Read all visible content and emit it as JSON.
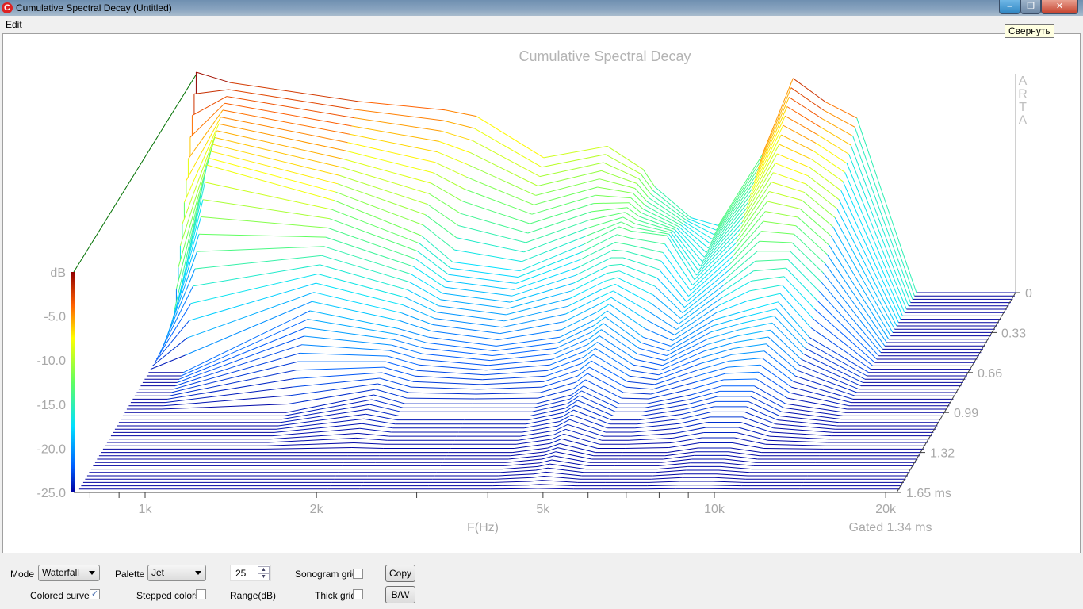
{
  "window": {
    "title": "Cumulative Spectral Decay  (Untitled)",
    "tooltip": "Свернуть",
    "minimize": "–",
    "restore": "❐",
    "close": "✕"
  },
  "menu": {
    "items": [
      "Edit"
    ]
  },
  "controls": {
    "mode_label": "Mode",
    "mode_value": "Waterfall",
    "palette_label": "Palette",
    "palette_value": "Jet",
    "range_value": "25",
    "range_label": "Range(dB)",
    "sonogram_grid_label": "Sonogram grid",
    "sonogram_grid_checked": false,
    "thick_grid_label": "Thick grid",
    "thick_grid_checked": false,
    "colored_curves_label": "Colored curves",
    "colored_curves_checked": true,
    "stepped_colors_label": "Stepped colors",
    "stepped_colors_checked": false,
    "copy_label": "Copy",
    "bw_label": "B/W"
  },
  "chart_data": {
    "type": "line",
    "title": "Cumulative Spectral Decay",
    "watermark": "ARTA",
    "xlabel": "F(Hz)",
    "ylabel": "dB",
    "note": "Gated 1.34 ms",
    "palette": "jet",
    "x_scale": "log",
    "xlim": [
      760,
      21000
    ],
    "ylim": [
      -25,
      0
    ],
    "x_ticks": [
      {
        "value": 1000,
        "label": "1k"
      },
      {
        "value": 2000,
        "label": "2k"
      },
      {
        "value": 5000,
        "label": "5k"
      },
      {
        "value": 10000,
        "label": "10k"
      },
      {
        "value": 20000,
        "label": "20k"
      }
    ],
    "y_ticks": [
      "-5.0",
      "-10.0",
      "-15.0",
      "-20.0",
      "-25.0"
    ],
    "time_ticks": [
      "0",
      "0.33",
      "0.66",
      "0.99",
      "1.32",
      "1.65 ms"
    ],
    "time_range_ms": [
      0,
      1.65
    ],
    "frequencies_hz": [
      760,
      874,
      1460,
      2080,
      2360,
      3100,
      4010,
      4630,
      4860,
      5620,
      6280,
      7500,
      8500,
      9700,
      11000,
      14000,
      21000
    ],
    "series": [
      {
        "time_ms": 0,
        "db": [
          0,
          -1.2,
          -3.3,
          -4.3,
          -5,
          -9.7,
          -8.4,
          -11,
          -13,
          -16.5,
          -17.4,
          -9.4,
          -0.7,
          -3.4,
          -5.2,
          -25,
          -25
        ]
      },
      {
        "time_ms": 0.33,
        "db": [
          -25,
          -6,
          -10,
          -14,
          -17,
          -18,
          -15,
          -13,
          -13.5,
          -14,
          -19,
          -14,
          -9,
          -10,
          -13,
          -25,
          -25
        ]
      },
      {
        "time_ms": 0.66,
        "db": [
          -25,
          -25,
          -18,
          -20,
          -21,
          -22,
          -21,
          -19,
          -18,
          -21,
          -22,
          -19,
          -18,
          -17,
          -21,
          -25,
          -25
        ]
      },
      {
        "time_ms": 0.99,
        "db": [
          -25,
          -25,
          -25,
          -23,
          -24,
          -24,
          -24,
          -23,
          -22,
          -24,
          -24,
          -23,
          -22,
          -22,
          -24,
          -25,
          -25
        ]
      },
      {
        "time_ms": 1.32,
        "db": [
          -25,
          -25,
          -25,
          -25,
          -25,
          -25,
          -25,
          -24.5,
          -24,
          -25,
          -25,
          -25,
          -24.5,
          -24.5,
          -25,
          -25,
          -25
        ]
      },
      {
        "time_ms": 1.65,
        "db": [
          -25,
          -25,
          -25,
          -25,
          -25,
          -25,
          -25,
          -25,
          -25,
          -25,
          -25,
          -25,
          -25,
          -25,
          -25,
          -25,
          -25
        ]
      }
    ]
  }
}
